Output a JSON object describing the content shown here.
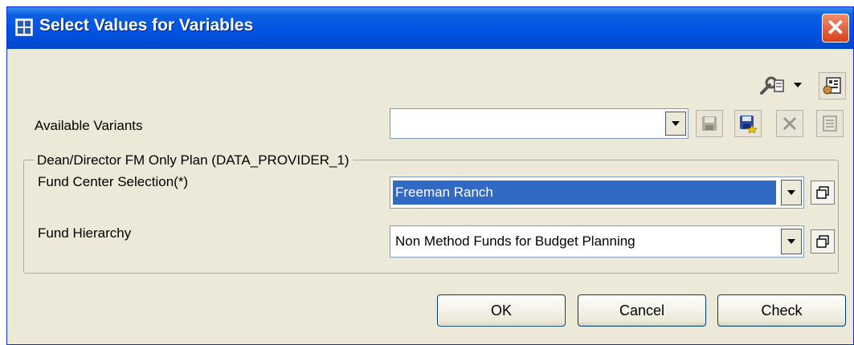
{
  "window": {
    "title": "Select Values for Variables",
    "close_glyph": "✕"
  },
  "toolbar": {
    "settings_icon": "wrench-settings-icon",
    "dropdown_icon": "caret-down-icon",
    "personalize_icon": "personalize-icon"
  },
  "variants": {
    "label": "Available Variants",
    "value": "",
    "actions": [
      "save-icon",
      "save-as-icon",
      "delete-icon",
      "details-icon"
    ]
  },
  "group": {
    "title": "Dean/Director FM Only Plan (DATA_PROVIDER_1)",
    "fields": [
      {
        "label": "Fund Center Selection(*)",
        "value": "Freeman Ranch"
      },
      {
        "label": "Fund Hierarchy",
        "value": "Non Method Funds for Budget Planning"
      }
    ]
  },
  "buttons": {
    "ok": "OK",
    "cancel": "Cancel",
    "check": "Check"
  },
  "colors": {
    "title_bar": "#0054e3",
    "dialog_bg": "#ece9d8",
    "selection": "#316ac5",
    "close": "#d8401a"
  }
}
